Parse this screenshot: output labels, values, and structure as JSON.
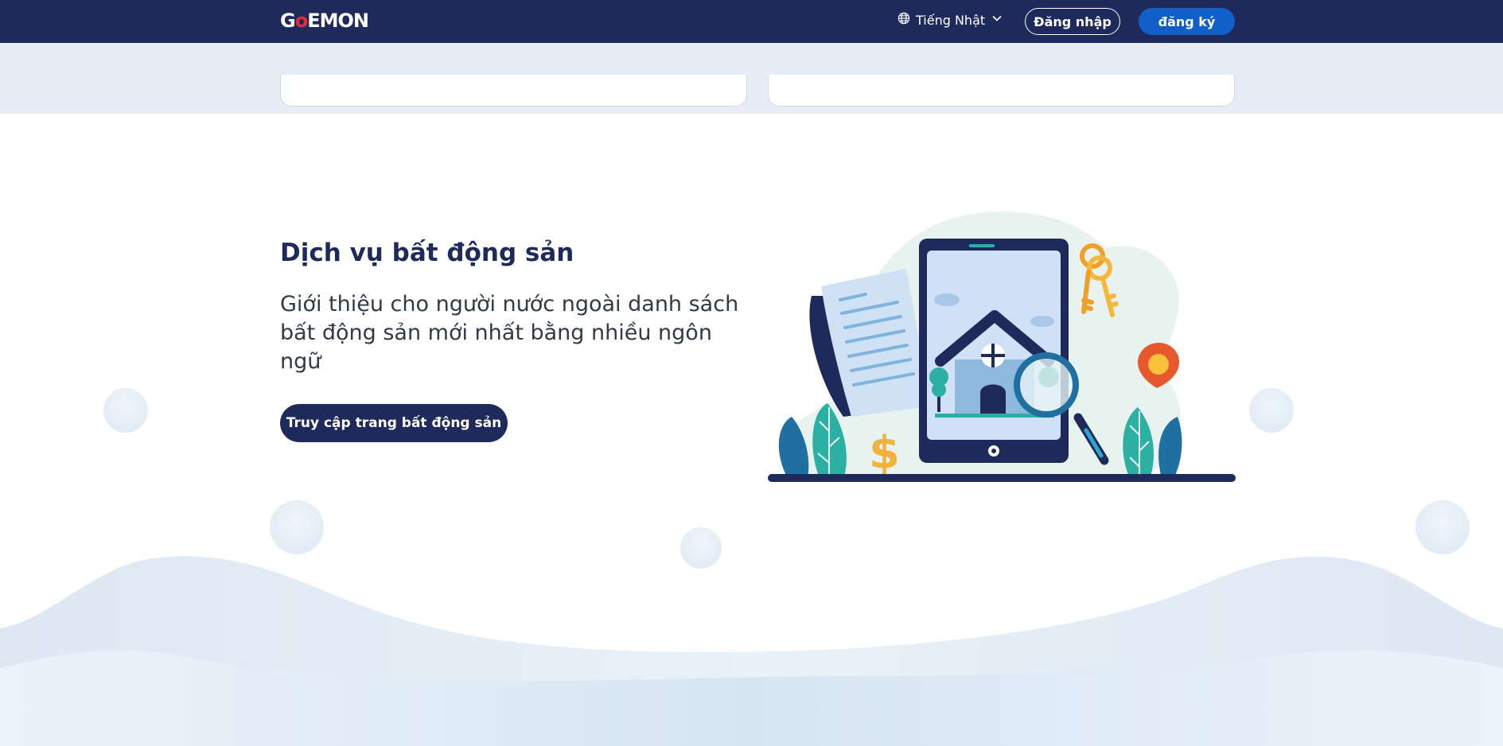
{
  "nav": {
    "logo": {
      "prefix": "G",
      "dot": "o",
      "suffix": "EMON"
    },
    "language_label": "Tiếng Nhật",
    "login_label": "Đăng nhập",
    "signup_label": "đăng ký"
  },
  "section": {
    "title": "Dịch vụ bất động sản",
    "description": "Giới thiệu cho người nước ngoài danh sách bất động sản mới nhất bằng nhiều ngôn ngữ",
    "cta_label": "Truy cập trang bất động sản"
  },
  "colors": {
    "nav_bg": "#1f2a5c",
    "signup_bg": "#1160c9",
    "band_bg": "#e6edf7",
    "title": "#1f2a5c"
  },
  "icons": [
    "globe-icon",
    "chevron-down-icon"
  ]
}
